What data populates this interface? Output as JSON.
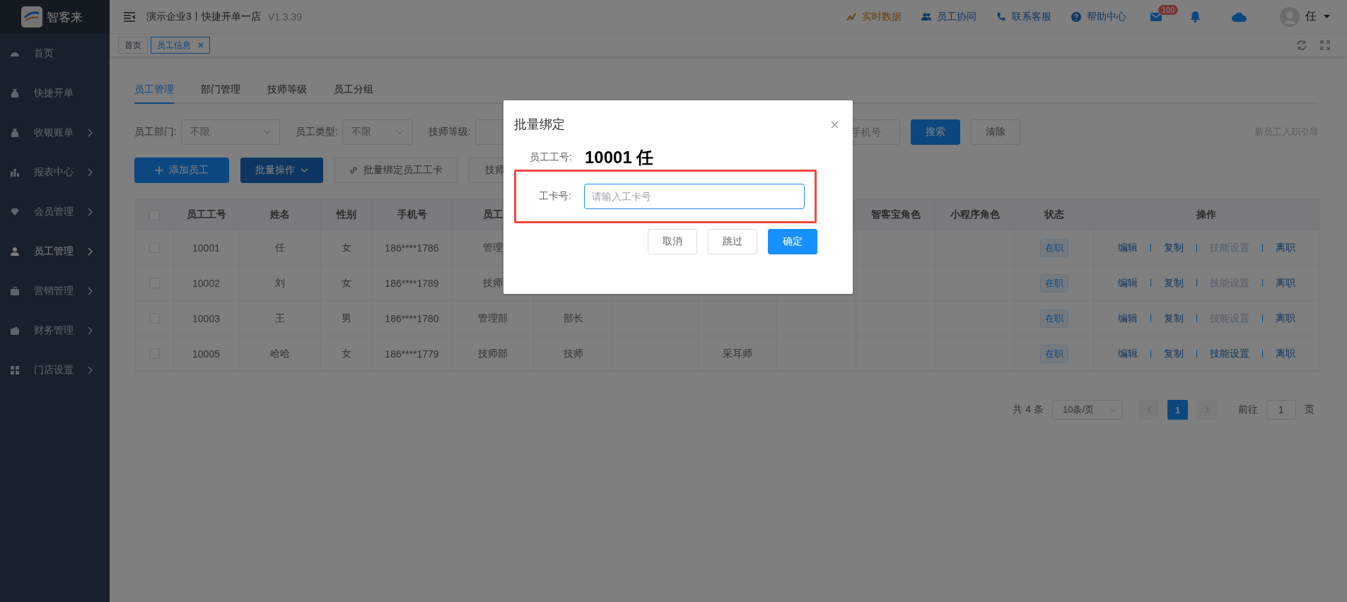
{
  "sidebar": {
    "logo_text": "智客来",
    "items": [
      {
        "label": "首页",
        "has_submenu": false,
        "selected": false
      },
      {
        "label": "快捷开单",
        "has_submenu": false,
        "selected": false
      },
      {
        "label": "收银账单",
        "has_submenu": true,
        "selected": false
      },
      {
        "label": "报表中心",
        "has_submenu": true,
        "selected": false
      },
      {
        "label": "会员管理",
        "has_submenu": true,
        "selected": false
      },
      {
        "label": "员工管理",
        "has_submenu": true,
        "selected": true
      },
      {
        "label": "营销管理",
        "has_submenu": true,
        "selected": false
      },
      {
        "label": "财务管理",
        "has_submenu": true,
        "selected": false
      },
      {
        "label": "门店设置",
        "has_submenu": true,
        "selected": false
      }
    ]
  },
  "header": {
    "title": "演示企业3丨快捷开单一店",
    "version": "V1.3.39",
    "links": [
      {
        "label": "实时数据",
        "kind": "realtime"
      },
      {
        "label": "员工协同",
        "kind": "team"
      },
      {
        "label": "联系客服",
        "kind": "phone"
      },
      {
        "label": "帮助中心",
        "kind": "help"
      }
    ],
    "mail_badge": "100",
    "user_name": "任"
  },
  "tag_bar": {
    "tags": [
      {
        "label": "首页",
        "selected": false,
        "closable": false
      },
      {
        "label": "员工信息",
        "selected": true,
        "closable": true
      }
    ]
  },
  "page_tabs": [
    {
      "label": "员工管理",
      "selected": true
    },
    {
      "label": "部门管理",
      "selected": false
    },
    {
      "label": "技师等级",
      "selected": false
    },
    {
      "label": "员工分组",
      "selected": false
    }
  ],
  "filters": [
    {
      "label": "员工部门:",
      "value": "不限"
    },
    {
      "label": "员工类型:",
      "value": "不限"
    },
    {
      "label": "技师等级:"
    }
  ],
  "phone_search": {
    "placeholder": "手机号"
  },
  "search_button": "搜索",
  "clear_button": "清除",
  "guide_link": "新员工入职引导",
  "toolbar": [
    {
      "label": "添加员工",
      "kind": "add"
    },
    {
      "label": "批量操作",
      "kind": "dropdown"
    },
    {
      "label": "批量绑定员工工卡",
      "kind": "link"
    },
    {
      "label": "技师",
      "kind": "plain"
    }
  ],
  "table": {
    "select_all_checked": false,
    "headers": {
      "employee_no": "员工工号",
      "name": "姓名",
      "gender": "性别",
      "phone": "手机号",
      "column_6": "员工",
      "zhikebao_role": "智客宝角色",
      "mini_program_role": "小程序角色",
      "status": "状态",
      "actions": "操作"
    },
    "rows": [
      {
        "checked": false,
        "employee_no": "10001",
        "name": "任",
        "gender": "女",
        "phone": "186****1786",
        "column_6": "管理",
        "status": "在职",
        "actions": [
          {
            "label": "编辑",
            "disabled": false
          },
          {
            "label": "复制",
            "disabled": false
          },
          {
            "label": "技能设置",
            "disabled": true
          },
          {
            "label": "离职",
            "disabled": false
          }
        ]
      },
      {
        "checked": false,
        "employee_no": "10002",
        "name": "刘",
        "gender": "女",
        "phone": "186****1789",
        "column_6": "技师",
        "status": "在职",
        "actions": [
          {
            "label": "编辑",
            "disabled": false
          },
          {
            "label": "复制",
            "disabled": false
          },
          {
            "label": "技能设置",
            "disabled": true
          },
          {
            "label": "离职",
            "disabled": false
          }
        ]
      },
      {
        "checked": false,
        "employee_no": "10003",
        "name": "王",
        "gender": "男",
        "phone": "186****1780",
        "column_6": "管理部",
        "column_7": "部长",
        "status": "在职",
        "actions": [
          {
            "label": "编辑",
            "disabled": false
          },
          {
            "label": "复制",
            "disabled": false
          },
          {
            "label": "技能设置",
            "disabled": true
          },
          {
            "label": "离职",
            "disabled": false
          }
        ]
      },
      {
        "checked": false,
        "employee_no": "10005",
        "name": "哈哈",
        "gender": "女",
        "phone": "186****1779",
        "column_6": "技师部",
        "column_7": "技师",
        "column_9": "采耳师",
        "status": "在职",
        "actions": [
          {
            "label": "编辑",
            "disabled": false
          },
          {
            "label": "复制",
            "disabled": false
          },
          {
            "label": "技能设置",
            "disabled": false
          },
          {
            "label": "离职",
            "disabled": false
          }
        ]
      }
    ]
  },
  "pagination": {
    "total": "共 4 条",
    "page_size": "10条/页",
    "pages": [
      {
        "label": "1",
        "selected": true
      }
    ],
    "goto_label": "前往",
    "goto_value": "1",
    "page_suffix": "页"
  },
  "dialog": {
    "title": "批量绑定",
    "employee_label": "员工工号:",
    "employee_value": "10001 任",
    "card_label": "工卡号:",
    "card_placeholder": "请输入工卡号",
    "highlighted": true,
    "buttons": [
      {
        "label": "取消",
        "kind": "default"
      },
      {
        "label": "跳过",
        "kind": "default"
      },
      {
        "label": "确定",
        "kind": "primary"
      }
    ]
  }
}
